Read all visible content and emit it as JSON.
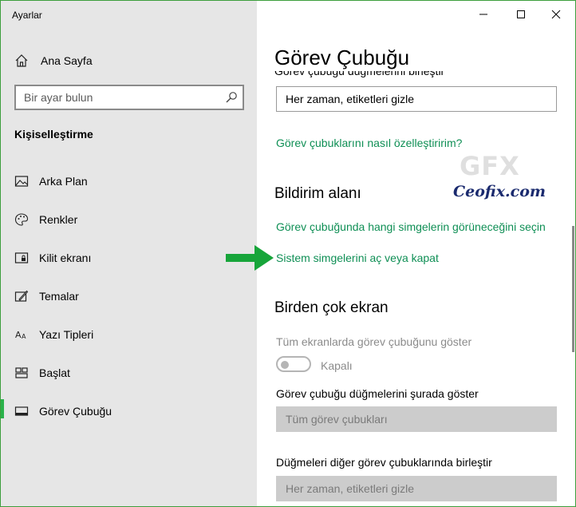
{
  "window": {
    "title": "Ayarlar",
    "controls": [
      "minimize",
      "maximize",
      "close"
    ]
  },
  "sidebar": {
    "home_label": "Ana Sayfa",
    "search_placeholder": "Bir ayar bulun",
    "section_title": "Kişiselleştirme",
    "items": [
      {
        "label": "Arka Plan",
        "icon": "image-icon"
      },
      {
        "label": "Renkler",
        "icon": "palette-icon"
      },
      {
        "label": "Kilit ekranı",
        "icon": "lock-screen-icon"
      },
      {
        "label": "Temalar",
        "icon": "themes-icon"
      },
      {
        "label": "Yazı Tipleri",
        "icon": "fonts-icon"
      },
      {
        "label": "Başlat",
        "icon": "start-icon"
      },
      {
        "label": "Görev Çubuğu",
        "icon": "taskbar-icon",
        "selected": true
      }
    ]
  },
  "content": {
    "page_title": "Görev Çubuğu",
    "clipped_label": "Görev çubuğu düğmelerini birleştir",
    "combine_dropdown_value": "Her zaman, etiketleri gizle",
    "customize_link": "Görev çubuklarını nasıl özelleştiririm?",
    "notification_heading": "Bildirim alanı",
    "select_icons_link": "Görev çubuğunda hangi simgelerin görüneceğini seçin",
    "system_icons_link": "Sistem simgelerini aç veya kapat",
    "multi_display_heading": "Birden çok ekran",
    "show_all_displays_label": "Tüm ekranlarda görev çubuğunu göster",
    "toggle_state_label": "Kapalı",
    "show_buttons_label": "Görev çubuğu düğmelerini şurada göster",
    "show_buttons_value": "Tüm görev çubukları",
    "combine_other_label": "Düğmeleri diğer görev çubuklarında birleştir",
    "combine_other_value": "Her zaman, etiketleri gizle"
  },
  "watermark": {
    "logo": "GFX",
    "text": "Ceofix.com"
  },
  "colors": {
    "accent": "#2ab24a",
    "link": "#0f8f55",
    "arrow": "#17a53a",
    "sidebar_bg": "#e6e6e6"
  }
}
